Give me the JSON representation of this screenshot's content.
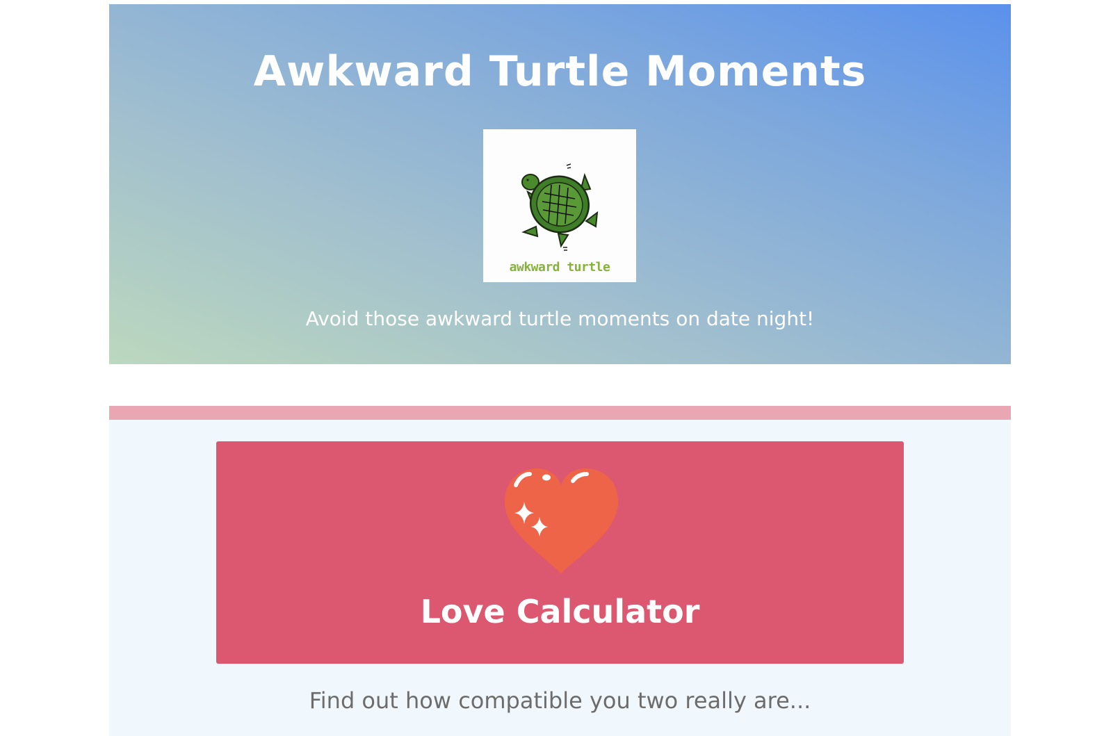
{
  "hero": {
    "title": "Awkward Turtle Moments",
    "logo_icon": "turtle-icon",
    "logo_text": "awkward turtle",
    "tagline": "Avoid those awkward turtle moments on date night!",
    "colors": {
      "gradient_start": "#bcd8be",
      "gradient_end": "#5a91ec"
    }
  },
  "love_calculator": {
    "icon": "sparkling-heart-icon",
    "title": "Love Calculator",
    "subtitle": "Find out how compatible you two really are...",
    "colors": {
      "card": "#dc5770",
      "accent_bar": "#e9a7b3",
      "heart": "#ee6448"
    }
  }
}
